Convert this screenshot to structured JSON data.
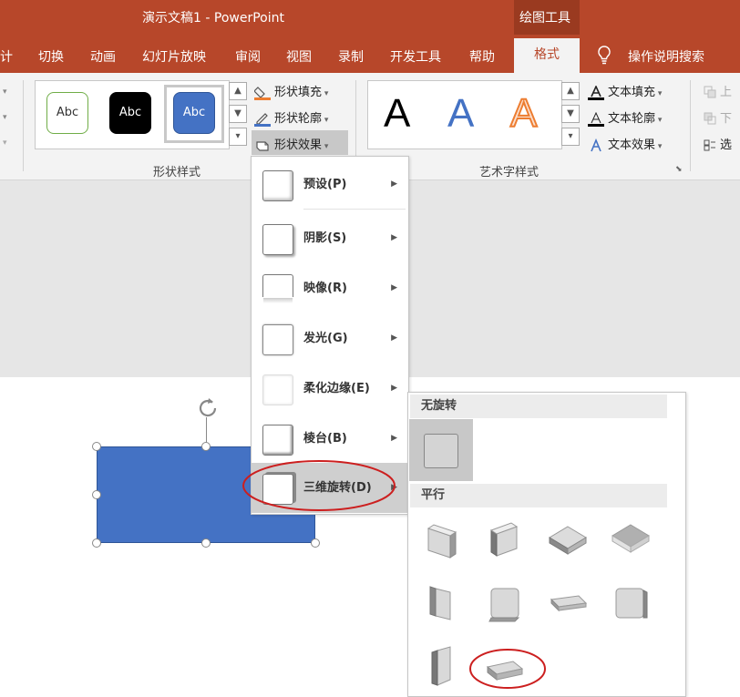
{
  "title": {
    "document": "演示文稿1",
    "separator": "-",
    "app": "PowerPoint",
    "context_tools": "绘图工具"
  },
  "tabs": [
    {
      "label": "计"
    },
    {
      "label": "切换"
    },
    {
      "label": "动画"
    },
    {
      "label": "幻灯片放映"
    },
    {
      "label": "审阅"
    },
    {
      "label": "视图"
    },
    {
      "label": "录制"
    },
    {
      "label": "开发工具"
    },
    {
      "label": "帮助"
    },
    {
      "label": "格式",
      "active": true
    },
    {
      "label": "操作说明搜索",
      "icon": "lightbulb-icon"
    }
  ],
  "shape_styles": {
    "presets": [
      {
        "label": "Abc",
        "fill": "#ffffff",
        "border": "#70ad47",
        "text_color": "#333333"
      },
      {
        "label": "Abc",
        "fill": "#000000",
        "border": "#000000",
        "text_color": "#ffffff"
      },
      {
        "label": "Abc",
        "fill": "#4472c4",
        "border": "#2f5597",
        "text_color": "#ffffff"
      }
    ],
    "commands": [
      {
        "label": "形状填充",
        "icon": "paint-bucket-icon"
      },
      {
        "label": "形状轮廓",
        "icon": "pencil-outline-icon"
      },
      {
        "label": "形状效果",
        "icon": "shape-effects-icon",
        "active": true
      }
    ],
    "group_label": "形状样式"
  },
  "wordart_styles": {
    "presets": [
      {
        "label": "A",
        "color": "#000000",
        "style": "solid"
      },
      {
        "label": "A",
        "color": "#4472c4",
        "style": "solid"
      },
      {
        "label": "A",
        "color": "#ed7d31",
        "style": "outline"
      }
    ],
    "commands": [
      {
        "label": "文本填充",
        "icon": "text-fill-icon"
      },
      {
        "label": "文本轮廓",
        "icon": "text-outline-icon"
      },
      {
        "label": "文本效果",
        "icon": "text-effects-icon"
      }
    ],
    "group_label": "艺术字样式"
  },
  "arrange_partial": [
    {
      "label": "上"
    },
    {
      "label": "下"
    },
    {
      "label": "选"
    }
  ],
  "effects_menu": {
    "items": [
      {
        "label": "预设(P)",
        "icon": "preset-effect-icon"
      },
      {
        "label": "阴影(S)",
        "icon": "shadow-effect-icon"
      },
      {
        "label": "映像(R)",
        "icon": "reflection-effect-icon"
      },
      {
        "label": "发光(G)",
        "icon": "glow-effect-icon"
      },
      {
        "label": "柔化边缘(E)",
        "icon": "soft-edges-icon"
      },
      {
        "label": "棱台(B)",
        "icon": "bevel-effect-icon"
      },
      {
        "label": "三维旋转(D)",
        "icon": "3d-rotation-icon",
        "active": true,
        "circled": true
      }
    ]
  },
  "rotation_submenu": {
    "sections": [
      {
        "title": "无旋转",
        "presets": [
          "no-rotation"
        ]
      },
      {
        "title": "平行",
        "presets": [
          "isometric-left-down",
          "isometric-right-up",
          "isometric-top-up",
          "isometric-top-down",
          "off-axis-left",
          "off-axis-right",
          "oblique-top",
          "off-axis-right-alt",
          "isometric-left-tall",
          "oblique-bottom-selected"
        ]
      }
    ],
    "circled_preset": "oblique-bottom-selected"
  },
  "slide": {
    "shape_color": "#4472c4"
  },
  "colors": {
    "accent": "#b7472a",
    "highlight_circle": "#cc1f1f"
  }
}
